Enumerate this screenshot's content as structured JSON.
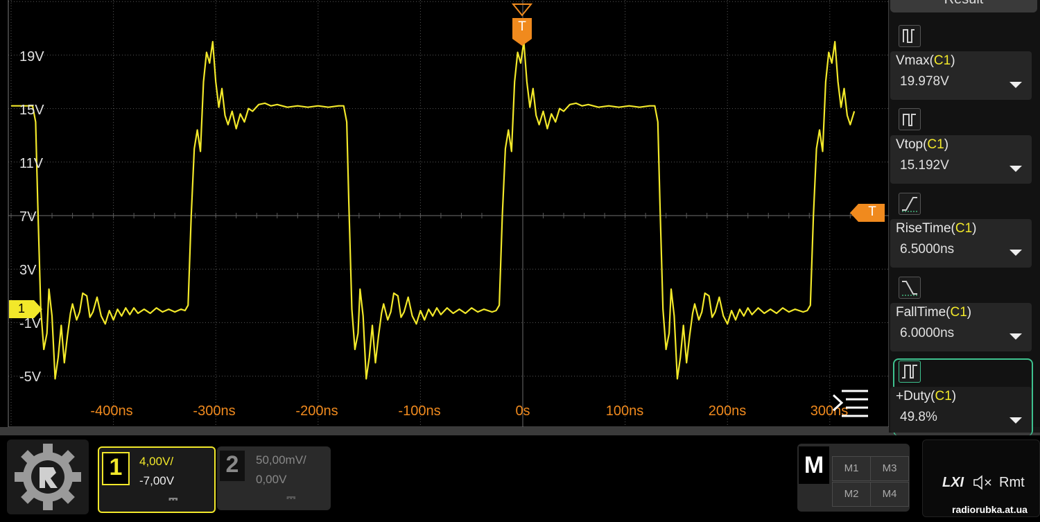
{
  "colors": {
    "channel1": "#f2e82a",
    "trigger": "#f08a1e",
    "grid": "#5a5a5a"
  },
  "voltage_labels": [
    "19V",
    "15V",
    "11V",
    "7V",
    "3V",
    "-1V",
    "-5V"
  ],
  "time_labels": [
    "-400ns",
    "-300ns",
    "-200ns",
    "-100ns",
    "0s",
    "100ns",
    "200ns",
    "300ns"
  ],
  "trigger": {
    "top_marker": "T",
    "level_marker": "T"
  },
  "channel_marker": "1",
  "measure_panel": {
    "tab_label": "Result",
    "items": [
      {
        "name": "Vmax",
        "source": "C1",
        "value": "19.978V",
        "icon": "pulse-max-icon"
      },
      {
        "name": "Vtop",
        "source": "C1",
        "value": "15.192V",
        "icon": "pulse-top-icon"
      },
      {
        "name": "RiseTime",
        "source": "C1",
        "value": "6.5000ns",
        "icon": "rise-edge-icon"
      },
      {
        "name": "FallTime",
        "source": "C1",
        "value": "6.0000ns",
        "icon": "fall-edge-icon"
      },
      {
        "name": "+Duty",
        "source": "C1",
        "value": "49.8%",
        "icon": "duty-cycle-icon"
      }
    ]
  },
  "menu_icon": "menu-lines-icon",
  "channels": [
    {
      "num": "1",
      "scale": "4,00V/",
      "offset": "-7,00V",
      "coupling": "⎓"
    },
    {
      "num": "2",
      "scale": "50,00mV/",
      "offset": "0,00V",
      "coupling": "⎓"
    }
  ],
  "math": {
    "label": "M",
    "buttons": [
      "M1",
      "M3",
      "M2",
      "M4"
    ]
  },
  "status": {
    "lxi": "LXI",
    "remote": "Rmt"
  },
  "watermark": "radiorubka.at.ua",
  "chart_data": {
    "type": "line",
    "title": "",
    "xlabel": "",
    "ylabel": "",
    "x_unit": "ns",
    "y_unit": "V",
    "xlim": [
      -500,
      350
    ],
    "ylim": [
      -7,
      21
    ],
    "grid": true,
    "series": [
      {
        "color": "#f2e82a",
        "points": [
          [
            -500,
            15.2
          ],
          [
            -479,
            15.2
          ],
          [
            -476,
            14
          ],
          [
            -474,
            8
          ],
          [
            -471,
            0
          ],
          [
            -468,
            -3
          ],
          [
            -465,
            -1.8
          ],
          [
            -463,
            1.5
          ],
          [
            -460,
            -0.5
          ],
          [
            -457,
            -5.2
          ],
          [
            -454,
            -3.6
          ],
          [
            -451,
            -1.2
          ],
          [
            -448,
            -4
          ],
          [
            -445,
            -2
          ],
          [
            -442,
            -0.3
          ],
          [
            -440,
            0.4
          ],
          [
            -436,
            -0.8
          ],
          [
            -433,
            -0.2
          ],
          [
            -430,
            1.2
          ],
          [
            -426,
            1
          ],
          [
            -423,
            -0.6
          ],
          [
            -420,
            -0.2
          ],
          [
            -416,
            0.9
          ],
          [
            -412,
            -0.5
          ],
          [
            -408,
            -1.1
          ],
          [
            -404,
            -0.1
          ],
          [
            -400,
            -0.8
          ],
          [
            -396,
            0
          ],
          [
            -392,
            -0.5
          ],
          [
            -388,
            0.1
          ],
          [
            -384,
            -0.4
          ],
          [
            -380,
            0.1
          ],
          [
            -376,
            -0.3
          ],
          [
            -370,
            0
          ],
          [
            -364,
            -0.3
          ],
          [
            -358,
            0.1
          ],
          [
            -352,
            -0.2
          ],
          [
            -346,
            0
          ],
          [
            -340,
            -0.2
          ],
          [
            -334,
            0
          ],
          [
            -330,
            -0.1
          ],
          [
            -327,
            0.3
          ],
          [
            -324,
            7
          ],
          [
            -321,
            12
          ],
          [
            -318,
            13.4
          ],
          [
            -315,
            11.8
          ],
          [
            -312,
            17
          ],
          [
            -309,
            19.2
          ],
          [
            -306,
            18.4
          ],
          [
            -303,
            20
          ],
          [
            -300,
            17
          ],
          [
            -297,
            15.1
          ],
          [
            -294,
            16.5
          ],
          [
            -291,
            14.5
          ],
          [
            -288,
            13.8
          ],
          [
            -284,
            14.8
          ],
          [
            -280,
            13.5
          ],
          [
            -276,
            14.6
          ],
          [
            -272,
            14
          ],
          [
            -268,
            15
          ],
          [
            -264,
            14.8
          ],
          [
            -258,
            15.3
          ],
          [
            -252,
            15.4
          ],
          [
            -246,
            15.2
          ],
          [
            -240,
            15.3
          ],
          [
            -230,
            15.1
          ],
          [
            -220,
            15.2
          ],
          [
            -210,
            15.1
          ],
          [
            -200,
            15.2
          ],
          [
            -190,
            15.1
          ],
          [
            -180,
            15.2
          ],
          [
            -175,
            15.2
          ],
          [
            -172,
            14
          ],
          [
            -170,
            8
          ],
          [
            -167,
            0
          ],
          [
            -164,
            -3
          ],
          [
            -161,
            -1.8
          ],
          [
            -159,
            1.5
          ],
          [
            -156,
            -0.5
          ],
          [
            -153,
            -5.2
          ],
          [
            -150,
            -3.6
          ],
          [
            -147,
            -1.2
          ],
          [
            -144,
            -4
          ],
          [
            -141,
            -2
          ],
          [
            -138,
            -0.3
          ],
          [
            -136,
            0.4
          ],
          [
            -132,
            -0.8
          ],
          [
            -129,
            -0.2
          ],
          [
            -126,
            1.2
          ],
          [
            -122,
            1
          ],
          [
            -119,
            -0.6
          ],
          [
            -116,
            -0.2
          ],
          [
            -112,
            0.9
          ],
          [
            -108,
            -0.5
          ],
          [
            -104,
            -1.1
          ],
          [
            -100,
            -0.1
          ],
          [
            -96,
            -0.8
          ],
          [
            -92,
            0
          ],
          [
            -88,
            -0.5
          ],
          [
            -84,
            0.1
          ],
          [
            -80,
            -0.4
          ],
          [
            -74,
            0.1
          ],
          [
            -68,
            -0.3
          ],
          [
            -62,
            0
          ],
          [
            -56,
            -0.3
          ],
          [
            -50,
            0.1
          ],
          [
            -44,
            -0.2
          ],
          [
            -38,
            0
          ],
          [
            -30,
            -0.2
          ],
          [
            -26,
            -0.1
          ],
          [
            -23,
            0.3
          ],
          [
            -20,
            7
          ],
          [
            -17,
            12
          ],
          [
            -14,
            13.4
          ],
          [
            -11,
            11.8
          ],
          [
            -8,
            17
          ],
          [
            -5,
            19.2
          ],
          [
            -2,
            18.4
          ],
          [
            1,
            20
          ],
          [
            4,
            17
          ],
          [
            7,
            15.1
          ],
          [
            10,
            16.5
          ],
          [
            13,
            14.5
          ],
          [
            16,
            13.8
          ],
          [
            20,
            14.8
          ],
          [
            24,
            13.5
          ],
          [
            28,
            14.6
          ],
          [
            32,
            14
          ],
          [
            36,
            15
          ],
          [
            40,
            14.8
          ],
          [
            46,
            15.3
          ],
          [
            52,
            15.4
          ],
          [
            58,
            15.2
          ],
          [
            64,
            15.3
          ],
          [
            74,
            15.1
          ],
          [
            84,
            15.2
          ],
          [
            94,
            15.1
          ],
          [
            104,
            15.2
          ],
          [
            114,
            15.1
          ],
          [
            124,
            15.2
          ],
          [
            129,
            15.2
          ],
          [
            132,
            14
          ],
          [
            134,
            8
          ],
          [
            137,
            0
          ],
          [
            140,
            -3
          ],
          [
            143,
            -1.8
          ],
          [
            145,
            1.5
          ],
          [
            148,
            -0.5
          ],
          [
            151,
            -5.2
          ],
          [
            154,
            -3.6
          ],
          [
            157,
            -1.2
          ],
          [
            160,
            -4
          ],
          [
            163,
            -2
          ],
          [
            166,
            -0.3
          ],
          [
            168,
            0.4
          ],
          [
            172,
            -0.8
          ],
          [
            175,
            -0.2
          ],
          [
            178,
            1.2
          ],
          [
            182,
            1
          ],
          [
            185,
            -0.6
          ],
          [
            188,
            -0.2
          ],
          [
            192,
            0.9
          ],
          [
            196,
            -0.5
          ],
          [
            200,
            -1.1
          ],
          [
            204,
            -0.1
          ],
          [
            208,
            -0.8
          ],
          [
            212,
            0
          ],
          [
            216,
            -0.5
          ],
          [
            220,
            0.1
          ],
          [
            224,
            -0.4
          ],
          [
            230,
            0.1
          ],
          [
            236,
            -0.3
          ],
          [
            242,
            0
          ],
          [
            248,
            -0.3
          ],
          [
            254,
            0.1
          ],
          [
            260,
            -0.2
          ],
          [
            266,
            0
          ],
          [
            274,
            -0.2
          ],
          [
            278,
            -0.1
          ],
          [
            281,
            0.3
          ],
          [
            284,
            7
          ],
          [
            287,
            12
          ],
          [
            290,
            13.4
          ],
          [
            293,
            11.8
          ],
          [
            296,
            17
          ],
          [
            299,
            19.2
          ],
          [
            302,
            18.4
          ],
          [
            305,
            20
          ],
          [
            308,
            17
          ],
          [
            311,
            15.1
          ],
          [
            314,
            16.5
          ],
          [
            317,
            14.5
          ],
          [
            320,
            13.8
          ],
          [
            324,
            14.8
          ]
        ]
      }
    ]
  }
}
